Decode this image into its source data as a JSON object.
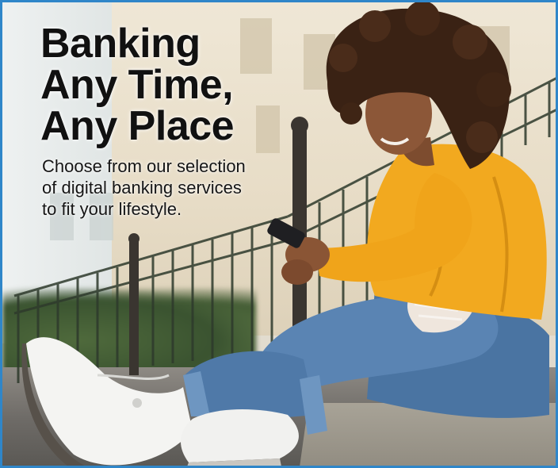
{
  "headline": {
    "line1": "Banking",
    "line2": "Any Time,",
    "line3": "Any Place"
  },
  "subheadline": {
    "line1": "Choose from our selection",
    "line2": "of digital banking services",
    "line3": "to fit your lifestyle."
  },
  "photo": {
    "subject": "woman-using-smartphone",
    "colors": {
      "border": "#2f86c9",
      "sweater": "#f2a91f",
      "jeans": "#4f79a8",
      "sneakers": "#f4f4f2"
    }
  }
}
